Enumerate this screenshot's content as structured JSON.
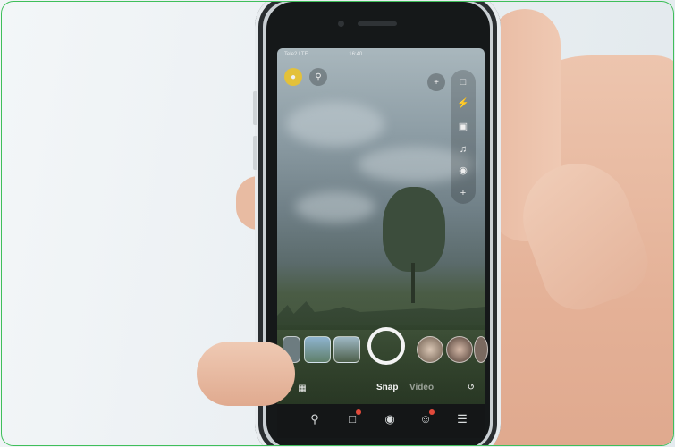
{
  "camera_ui": {
    "status_left": "Tele2 LTE",
    "status_time": "16:40",
    "modes": {
      "snap": "Snap",
      "video": "Video"
    }
  },
  "icons": {
    "bitmoji": "bitmoji-avatar-icon",
    "search": "search-icon",
    "add_friend": "add-friend-icon",
    "flip": "flip-camera-icon",
    "flash": "flash-icon",
    "video_camera": "video-camera-icon",
    "music": "music-note-icon",
    "lens": "lens-icon",
    "plus": "plus-icon",
    "memories": "memories-icon",
    "lens_explore": "lens-explore-icon",
    "map": "map-pin-icon",
    "chat": "chat-icon",
    "camera": "camera-icon",
    "stories": "stories-icon",
    "spotlight": "spotlight-icon"
  },
  "colors": {
    "frame_border": "#3fbf5a",
    "bitmoji": "#e3c13a",
    "badge": "#e24a3b"
  }
}
